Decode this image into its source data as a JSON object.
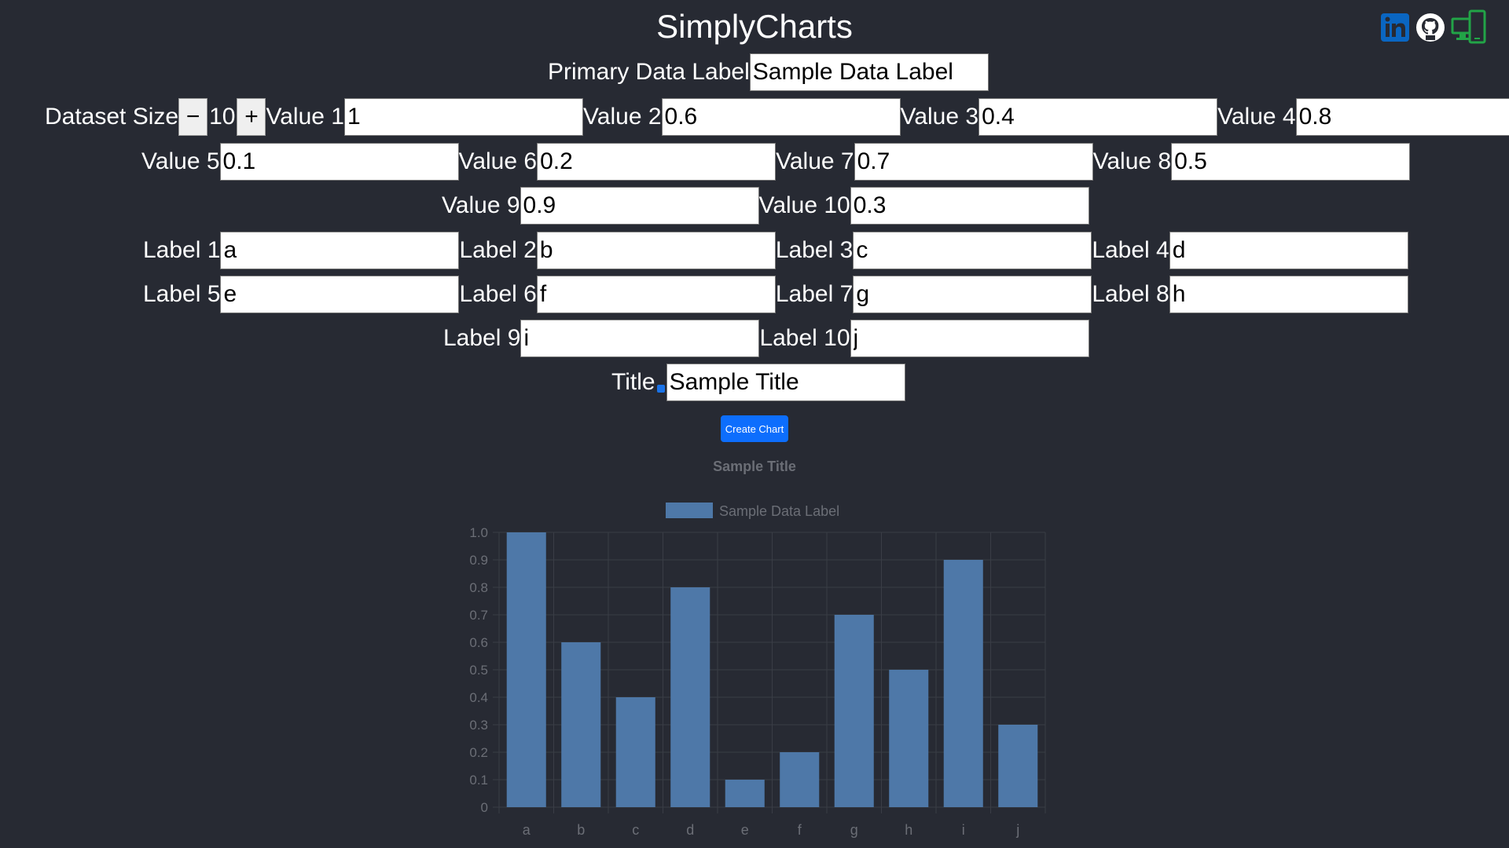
{
  "app": {
    "title": "SimplyCharts"
  },
  "social": {
    "linkedin_icon": "linkedin-icon",
    "github_icon": "github-icon",
    "devices_icon": "devices-icon"
  },
  "form": {
    "primary_label": {
      "label": "Primary Data Label",
      "value": "Sample Data Label"
    },
    "dataset_size": {
      "label": "Dataset Size",
      "minus": "−",
      "plus": "+",
      "value": "10"
    },
    "values": [
      {
        "label": "Value 1",
        "value": "1"
      },
      {
        "label": "Value 2",
        "value": "0.6"
      },
      {
        "label": "Value 3",
        "value": "0.4"
      },
      {
        "label": "Value 4",
        "value": "0.8"
      },
      {
        "label": "Value 5",
        "value": "0.1"
      },
      {
        "label": "Value 6",
        "value": "0.2"
      },
      {
        "label": "Value 7",
        "value": "0.7"
      },
      {
        "label": "Value 8",
        "value": "0.5"
      },
      {
        "label": "Value 9",
        "value": "0.9"
      },
      {
        "label": "Value 10",
        "value": "0.3"
      }
    ],
    "labels": [
      {
        "label": "Label 1",
        "value": "a"
      },
      {
        "label": "Label 2",
        "value": "b"
      },
      {
        "label": "Label 3",
        "value": "c"
      },
      {
        "label": "Label 4",
        "value": "d"
      },
      {
        "label": "Label 5",
        "value": "e"
      },
      {
        "label": "Label 6",
        "value": "f"
      },
      {
        "label": "Label 7",
        "value": "g"
      },
      {
        "label": "Label 8",
        "value": "h"
      },
      {
        "label": "Label 9",
        "value": "i"
      },
      {
        "label": "Label 10",
        "value": "j"
      }
    ],
    "title": {
      "label": "Title",
      "value": "Sample Title",
      "checked": true
    },
    "create_button": "Create Chart"
  },
  "colors": {
    "background": "#272a33",
    "bar": "#4e78a8",
    "button": "#0d6efd",
    "grid": "#3a3d46",
    "axis_text": "#6b6e76"
  },
  "chart_data": {
    "type": "bar",
    "title": "Sample Title",
    "categories": [
      "a",
      "b",
      "c",
      "d",
      "e",
      "f",
      "g",
      "h",
      "i",
      "j"
    ],
    "series": [
      {
        "name": "Sample Data Label",
        "values": [
          1,
          0.6,
          0.4,
          0.8,
          0.1,
          0.2,
          0.7,
          0.5,
          0.9,
          0.3
        ]
      }
    ],
    "ylim": [
      0,
      1.0
    ],
    "yticks": [
      "0",
      "0.1",
      "0.2",
      "0.3",
      "0.4",
      "0.5",
      "0.6",
      "0.7",
      "0.8",
      "0.9",
      "1.0"
    ],
    "grid": true,
    "legend": "top"
  }
}
